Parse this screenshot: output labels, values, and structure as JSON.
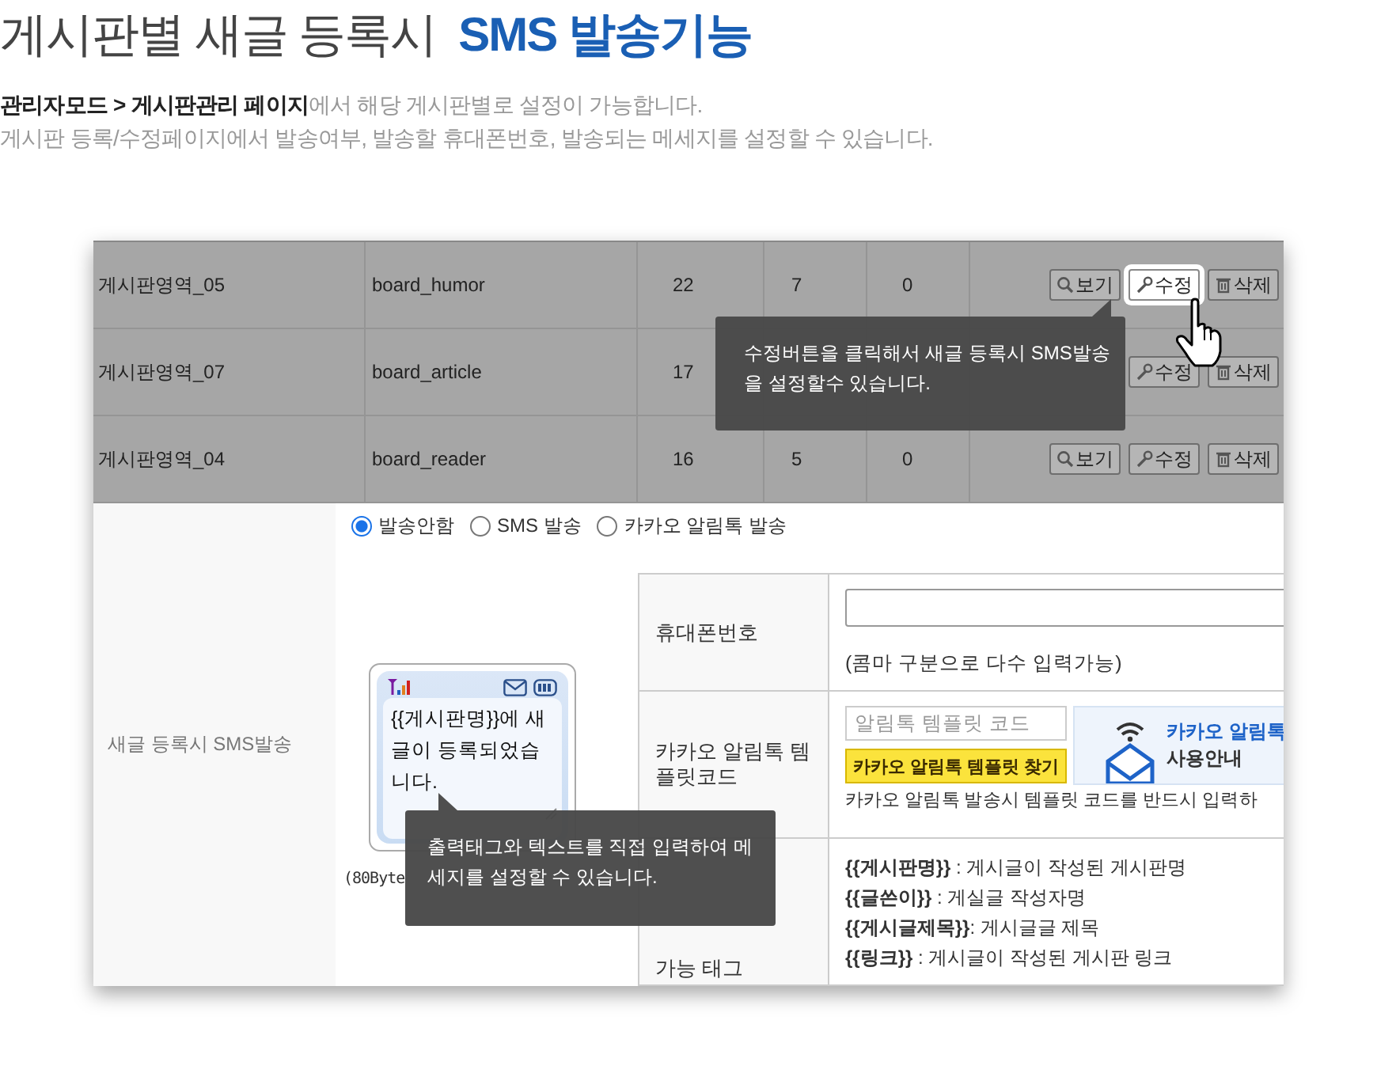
{
  "heading": {
    "title": "게시판별 새글 등록시",
    "highlight": "SMS 발송기능"
  },
  "intro": [
    "**관리자모드 > 게시판관리 페이지**에서 해당 게시판별로 설정이 가능합니다.",
    "게시판 등록/수정페이지에서 발송여부, 발송할 휴대폰번호, 발송되는 메세지를 설정할 수 있습니다."
  ],
  "board_rows": [
    {
      "cells": [
        "게시판영역_05",
        "board_humor",
        "22",
        "7",
        "0"
      ],
      "buttons": [
        {
          "kind": "view",
          "label": "보기",
          "highlighted": false
        },
        {
          "kind": "edit",
          "label": "수정",
          "highlighted": true
        },
        {
          "kind": "delete",
          "label": "삭제",
          "highlighted": false
        }
      ]
    },
    {
      "cells": [
        "게시판영역_07",
        "board_article",
        "17"
      ],
      "buttons": [
        {
          "kind": "edit",
          "label": "수정",
          "highlighted": false
        },
        {
          "kind": "delete",
          "label": "삭제",
          "highlighted": false
        }
      ]
    },
    {
      "cells": [
        "게시판영역_04",
        "board_reader",
        "16",
        "5",
        "0"
      ],
      "buttons": [
        {
          "kind": "view",
          "label": "보기",
          "highlighted": false
        },
        {
          "kind": "edit",
          "label": "수정",
          "highlighted": false
        },
        {
          "kind": "delete",
          "label": "삭제",
          "highlighted": false
        }
      ]
    }
  ],
  "sms_setting": {
    "label": "새글 등록시 SMS발송",
    "options": [
      {
        "label": "발송안함",
        "selected": true
      },
      {
        "label": "SMS 발송",
        "selected": false
      },
      {
        "label": "카카오 알림톡 발송",
        "selected": false
      }
    ],
    "message": "{{게시판명}}에 새글이 등록되었습니다.",
    "byte_note": "(80Byte",
    "fields": [
      {
        "kind": "phone",
        "label": "휴대폰번호",
        "hint": "(콤마 구분으로 다수 입력가능)"
      },
      {
        "kind": "kakao",
        "label": "카카오 알림톡 템플릿코드",
        "placeholder": "알림톡 템플릿 코드",
        "button": "카카오 알림톡 템플릿 찾기",
        "guide_title": "카카오 알림톡",
        "guide_subtitle": "사용안내",
        "note": "카카오 알림톡 발송시 템플릿 코드를 반드시 입력하"
      },
      {
        "kind": "tags",
        "label": "가능 태그",
        "tags": [
          "**{{게시판명}}** : 게시글이 작성된 게시판명",
          "**{{글쓴이}}** : 게실글 작성자명",
          "**{{게시글제목}}**: 게시글글 제목",
          "**{{링크}}** : 게시글이 작성된 게시판 링크"
        ]
      }
    ]
  },
  "tooltips": [
    {
      "text": "수정버튼을 클릭해서 새글 등록시 SMS발송을 설정할수 있습니다."
    },
    {
      "text": "출력태그와 텍스트를 직접 입력하여 메세지를 설정할 수 있습니다."
    }
  ]
}
